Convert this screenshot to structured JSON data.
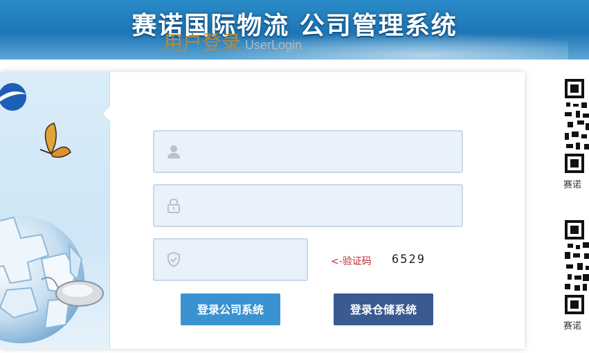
{
  "banner": {
    "title": "赛诺国际物流  公司管理系统"
  },
  "login": {
    "title_cn": "用户登录",
    "title_en": "UserLogin",
    "username": {
      "value": "",
      "placeholder": ""
    },
    "password": {
      "value": "",
      "placeholder": ""
    },
    "captcha": {
      "value": "",
      "placeholder": "",
      "hint": "<-验证码",
      "code": "6529"
    },
    "buttons": {
      "company": "登录公司系统",
      "warehouse": "登录仓储系统"
    }
  },
  "qr_codes": [
    {
      "label": "赛诺"
    },
    {
      "label": "赛诺"
    }
  ],
  "colors": {
    "banner": "#1f76b5",
    "title_accent": "#b38a3b",
    "button_company": "#3a92d0",
    "button_warehouse": "#3a5a90",
    "captcha_hint": "#c0282c"
  }
}
